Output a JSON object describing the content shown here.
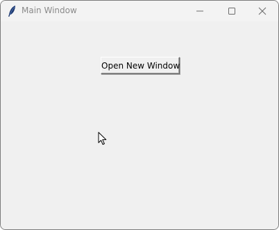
{
  "window": {
    "title": "Main Window",
    "app_icon": "feather-icon",
    "controls": [
      "minimize-icon",
      "maximize-icon",
      "close-icon"
    ]
  },
  "main": {
    "open_button_label": "Open New Window"
  },
  "cursor": "arrow-cursor-icon"
}
